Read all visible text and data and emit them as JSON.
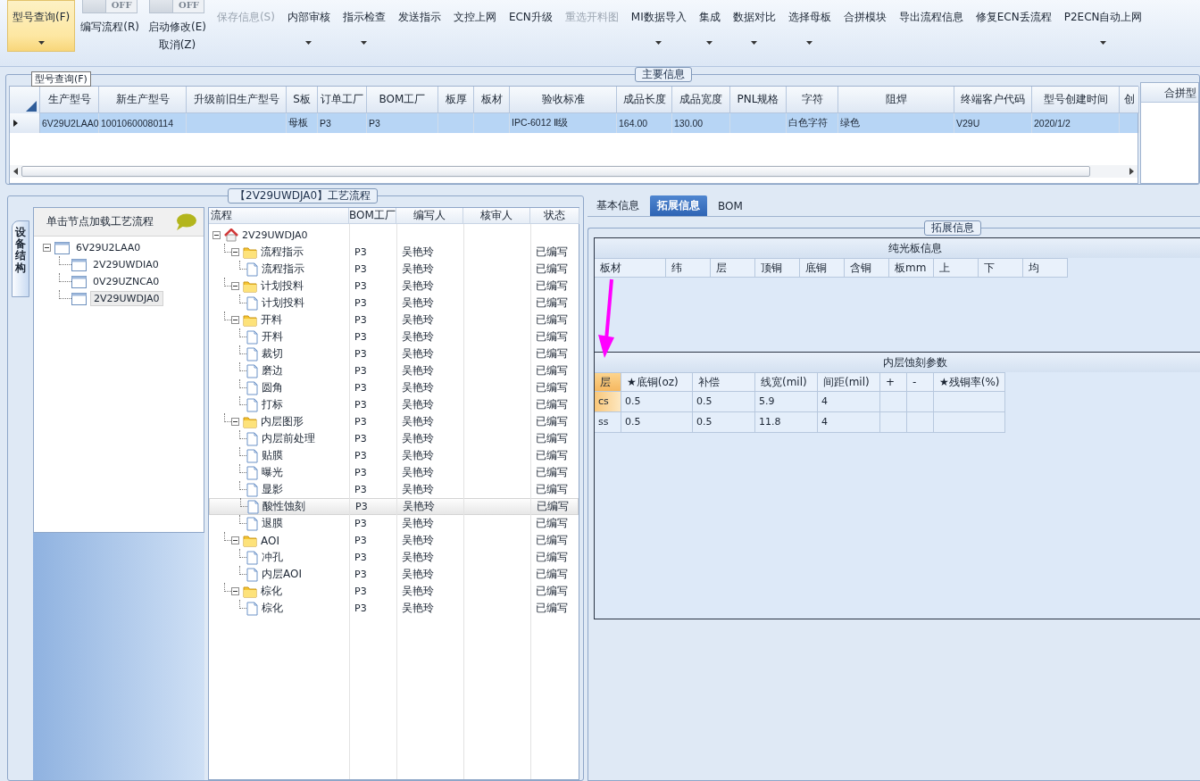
{
  "ribbon": {
    "items": [
      {
        "kind": "button",
        "label": "型号查询(F)",
        "selected": true,
        "disabled": false,
        "dropdown": true
      },
      {
        "kind": "toggle",
        "toggle_text": "OFF",
        "on": false,
        "labels": [
          "编写流程(R)"
        ]
      },
      {
        "kind": "toggle",
        "toggle_text": "OFF",
        "on": false,
        "labels": [
          "启动修改(E)",
          "取消(Z)"
        ]
      },
      {
        "kind": "button",
        "label": "保存信息(S)",
        "selected": false,
        "disabled": true,
        "dropdown": false
      },
      {
        "kind": "button",
        "label": "内部审核",
        "selected": false,
        "disabled": false,
        "dropdown": true
      },
      {
        "kind": "button",
        "label": "指示检查",
        "selected": false,
        "disabled": false,
        "dropdown": true
      },
      {
        "kind": "button",
        "label": "发送指示",
        "selected": false,
        "disabled": false,
        "dropdown": false
      },
      {
        "kind": "button",
        "label": "文控上网",
        "selected": false,
        "disabled": false,
        "dropdown": false
      },
      {
        "kind": "button",
        "label": "ECN升级",
        "selected": false,
        "disabled": false,
        "dropdown": false
      },
      {
        "kind": "button",
        "label": "重选开料图",
        "selected": false,
        "disabled": true,
        "dropdown": false
      },
      {
        "kind": "button",
        "label": "MI数据导入",
        "selected": false,
        "disabled": false,
        "dropdown": true
      },
      {
        "kind": "button",
        "label": "集成",
        "selected": false,
        "disabled": false,
        "dropdown": true
      },
      {
        "kind": "button",
        "label": "数据对比",
        "selected": false,
        "disabled": false,
        "dropdown": true
      },
      {
        "kind": "button",
        "label": "选择母板",
        "selected": false,
        "disabled": false,
        "dropdown": true
      },
      {
        "kind": "button",
        "label": "合拼模块",
        "selected": false,
        "disabled": false,
        "dropdown": false
      },
      {
        "kind": "button",
        "label": "导出流程信息",
        "selected": false,
        "disabled": false,
        "dropdown": false
      },
      {
        "kind": "button",
        "label": "修复ECN丢流程",
        "selected": false,
        "disabled": false,
        "dropdown": false
      },
      {
        "kind": "button",
        "label": "P2ECN自动上网",
        "selected": false,
        "disabled": false,
        "dropdown": true
      }
    ]
  },
  "main_info": {
    "title": "主要信息",
    "tooltip": "型号查询(F)",
    "columns": [
      "生产型号",
      "新生产型号",
      "升级前旧生产型号",
      "S板",
      "订单工厂",
      "BOM工厂",
      "板厚",
      "板材",
      "验收标准",
      "成品长度",
      "成品宽度",
      "PNL规格",
      "字符",
      "阻焊",
      "终端客户代码",
      "型号创建时间",
      "创"
    ],
    "rows": [
      {
        "selected": true,
        "cells": [
          "6V29U2LAA0",
          "10010600080114",
          null,
          "母板",
          "P3",
          "P3",
          null,
          null,
          "IPC-6012 Ⅱ级",
          "164.00",
          "130.00",
          null,
          "白色字符",
          "绿色",
          "V29U",
          "2020/1/2",
          null
        ]
      }
    ],
    "side_panel": {
      "title": "合拼型"
    }
  },
  "process": {
    "title": "【2V29UWDJA0】工艺流程",
    "side_tab": "设备结构",
    "tree_panel": {
      "header": "单击节点加载工艺流程",
      "nodes": [
        {
          "label": "6V29U2LAA0",
          "selected": false,
          "expanded": true,
          "children": [
            {
              "label": "2V29UWDIA0",
              "selected": false
            },
            {
              "label": "0V29UZNCA0",
              "selected": false
            },
            {
              "label": "2V29UWDJA0",
              "selected": true
            }
          ]
        }
      ]
    },
    "grid": {
      "columns": [
        "流程",
        "BOM工厂",
        "编写人",
        "核审人",
        "状态"
      ],
      "root": {
        "kind": "root",
        "label": "2V29UWDJA0",
        "selected": false,
        "expanded": true,
        "children": [
          {
            "kind": "folder",
            "label": "流程指示",
            "bom": "P3",
            "writer": "吴艳玲",
            "status": "已编写",
            "selected": false,
            "expanded": true,
            "children": [
              {
                "kind": "step",
                "label": "流程指示",
                "bom": "P3",
                "writer": "吴艳玲",
                "status": "已编写",
                "selected": false
              }
            ]
          },
          {
            "kind": "folder",
            "label": "计划投料",
            "bom": "P3",
            "writer": "吴艳玲",
            "status": "已编写",
            "selected": false,
            "expanded": true,
            "children": [
              {
                "kind": "step",
                "label": "计划投料",
                "bom": "P3",
                "writer": "吴艳玲",
                "status": "已编写",
                "selected": false
              }
            ]
          },
          {
            "kind": "folder",
            "label": "开料",
            "bom": "P3",
            "writer": "吴艳玲",
            "status": "已编写",
            "selected": false,
            "expanded": true,
            "children": [
              {
                "kind": "step",
                "label": "开料",
                "bom": "P3",
                "writer": "吴艳玲",
                "status": "已编写",
                "selected": false
              },
              {
                "kind": "step",
                "label": "裁切",
                "bom": "P3",
                "writer": "吴艳玲",
                "status": "已编写",
                "selected": false
              },
              {
                "kind": "step",
                "label": "磨边",
                "bom": "P3",
                "writer": "吴艳玲",
                "status": "已编写",
                "selected": false
              },
              {
                "kind": "step",
                "label": "圆角",
                "bom": "P3",
                "writer": "吴艳玲",
                "status": "已编写",
                "selected": false
              },
              {
                "kind": "step",
                "label": "打标",
                "bom": "P3",
                "writer": "吴艳玲",
                "status": "已编写",
                "selected": false
              }
            ]
          },
          {
            "kind": "folder",
            "label": "内层图形",
            "bom": "P3",
            "writer": "吴艳玲",
            "status": "已编写",
            "selected": false,
            "expanded": true,
            "children": [
              {
                "kind": "step",
                "label": "内层前处理",
                "bom": "P3",
                "writer": "吴艳玲",
                "status": "已编写",
                "selected": false
              },
              {
                "kind": "step",
                "label": "贴膜",
                "bom": "P3",
                "writer": "吴艳玲",
                "status": "已编写",
                "selected": false
              },
              {
                "kind": "step",
                "label": "曝光",
                "bom": "P3",
                "writer": "吴艳玲",
                "status": "已编写",
                "selected": false
              },
              {
                "kind": "step",
                "label": "显影",
                "bom": "P3",
                "writer": "吴艳玲",
                "status": "已编写",
                "selected": false
              },
              {
                "kind": "step",
                "label": "酸性蚀刻",
                "bom": "P3",
                "writer": "吴艳玲",
                "status": "已编写",
                "selected": true
              },
              {
                "kind": "step",
                "label": "退膜",
                "bom": "P3",
                "writer": "吴艳玲",
                "status": "已编写",
                "selected": false
              }
            ]
          },
          {
            "kind": "folder",
            "label": "AOI",
            "bom": "P3",
            "writer": "吴艳玲",
            "status": "已编写",
            "selected": false,
            "expanded": true,
            "children": [
              {
                "kind": "step",
                "label": "冲孔",
                "bom": "P3",
                "writer": "吴艳玲",
                "status": "已编写",
                "selected": false
              },
              {
                "kind": "step",
                "label": "内层AOI",
                "bom": "P3",
                "writer": "吴艳玲",
                "status": "已编写",
                "selected": false
              }
            ]
          },
          {
            "kind": "folder",
            "label": "棕化",
            "bom": "P3",
            "writer": "吴艳玲",
            "status": "已编写",
            "selected": false,
            "expanded": true,
            "children": [
              {
                "kind": "step",
                "label": "棕化",
                "bom": "P3",
                "writer": "吴艳玲",
                "status": "已编写",
                "selected": false
              }
            ]
          }
        ]
      }
    }
  },
  "detail": {
    "tabs": [
      {
        "label": "基本信息",
        "selected": false
      },
      {
        "label": "拓展信息",
        "selected": true
      },
      {
        "label": "BOM",
        "selected": false
      }
    ],
    "title": "拓展信息",
    "plain_board": {
      "title": "纯光板信息",
      "columns": [
        "板材",
        "纬",
        "层",
        "顶铜",
        "底铜",
        "含铜",
        "板mm",
        "上",
        "下",
        "均"
      ]
    },
    "etch": {
      "title": "内层蚀刻参数",
      "columns": [
        "层",
        "★底铜(oz)",
        "补偿",
        "线宽(mil)",
        "间距(mil)",
        "+",
        "-",
        "★残铜率(%)"
      ],
      "rows": [
        {
          "selected": true,
          "cells": [
            "cs",
            "0.5",
            "0.5",
            "5.9",
            "4",
            null,
            null,
            null
          ]
        },
        {
          "selected": false,
          "cells": [
            "ss",
            "0.5",
            "0.5",
            "11.8",
            "4",
            null,
            null,
            null
          ]
        }
      ]
    }
  }
}
